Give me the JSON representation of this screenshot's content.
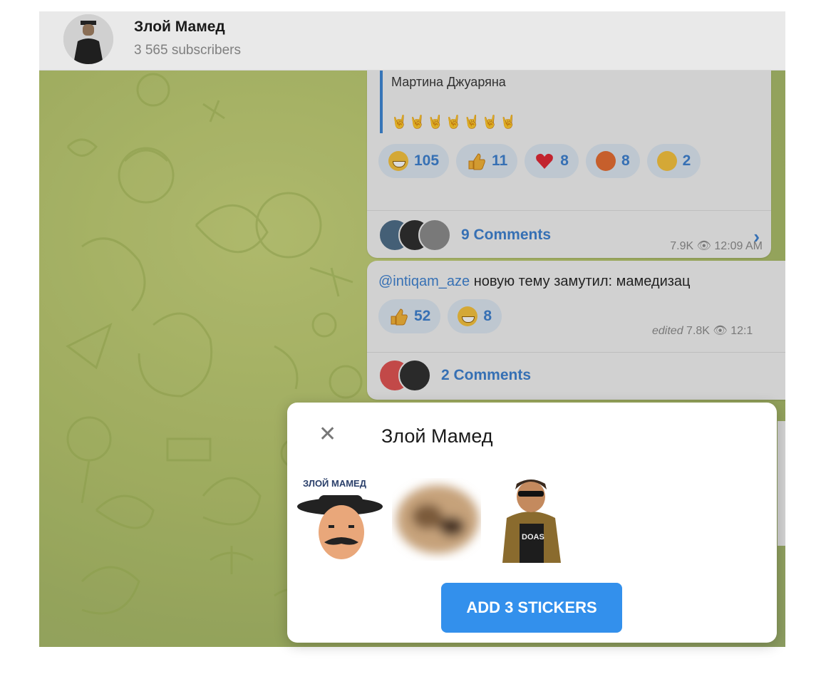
{
  "channel": {
    "title": "Злой Мамед",
    "subscribers": "3 565 subscribers",
    "avatar_icon": "profile-photo-icon"
  },
  "post1": {
    "quote_text": "Мартина Джуаряна",
    "hands_emoji": "🤘🤘🤘🤘🤘🤘🤘",
    "reactions": [
      {
        "emoji": "grinning-face-icon",
        "count": "105"
      },
      {
        "emoji": "thumbs-up-icon",
        "count": "11"
      },
      {
        "emoji": "red-heart-icon",
        "count": "8"
      },
      {
        "emoji": "angry-face-icon",
        "count": "8"
      },
      {
        "emoji": "thinking-face-icon",
        "count": "2"
      }
    ],
    "views": "7.9K",
    "time": "12:09 AM",
    "comments_label": "9 Comments"
  },
  "post2": {
    "mention": "@intiqam_aze",
    "text": " новую тему замутил: мамедизац",
    "reactions": [
      {
        "emoji": "thumbs-up-icon",
        "count": "52"
      },
      {
        "emoji": "grinning-face-icon",
        "count": "8"
      }
    ],
    "edited_label": "edited",
    "views": "7.8K",
    "time": "12:1",
    "comments_label": "2 Comments"
  },
  "sticker_modal": {
    "title": "Злой Мамед",
    "sticker1_caption": "ЗЛОЙ МАМЕД",
    "sticker3_shirt": "DOAS",
    "add_button": "ADD 3 STICKERS",
    "stickers": [
      "mustache-man-sticker",
      "blurred-sticker",
      "sunglasses-man-sticker"
    ]
  },
  "colors": {
    "accent": "#3390ec",
    "link": "#3a7fd0",
    "chip": "#dce6f1",
    "background": "#b5c56a"
  }
}
